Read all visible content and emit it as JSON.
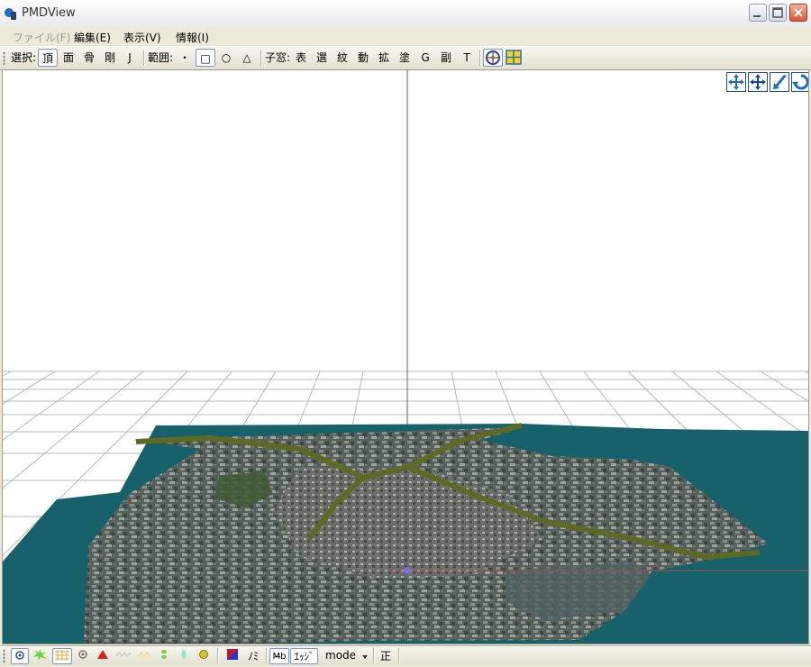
{
  "window": {
    "title": "PMDView"
  },
  "menu": [
    {
      "label": "ファイル(F)",
      "enabled": false
    },
    {
      "label": "編集(E)",
      "enabled": true
    },
    {
      "label": "表示(V)",
      "enabled": true
    },
    {
      "label": "情報(I)",
      "enabled": true
    }
  ],
  "toolbar": {
    "select_label": "選択:",
    "select_vertex": "頂",
    "select_face": "面",
    "select_bone": "骨",
    "select_rigid": "剛",
    "select_joint": "J",
    "range_label": "範囲:",
    "range_point": "・",
    "range_rect": "□",
    "range_circle": "○",
    "range_triangle": "△",
    "child_label": "子窓:",
    "child_table": "表",
    "child_select": "選",
    "child_morph": "紋",
    "child_motion": "動",
    "child_extend": "拡",
    "child_paint": "塗",
    "child_g": "G",
    "child_sub": "副",
    "child_t": "T"
  },
  "statusbar": {
    "nomi_label": "ﾉﾐ",
    "mb_label": "M̶b",
    "edge_label": "ｴｯｼﾞ",
    "mode_label": "mode",
    "sei_label": "正"
  },
  "colors": {
    "ground": "#17616a",
    "city_dark": "#4a4f4c",
    "city_light": "#8b8f8a",
    "river": "#5e6a24",
    "axis_green": "#2f8a2f",
    "axis_red": "#c24a4a",
    "grid": "#b8b8b8"
  },
  "icons": {
    "app": "pmd-app-icon",
    "nav": [
      "move-xy-icon",
      "move-xz-icon",
      "zoom-icon",
      "rotate-icon"
    ],
    "view": [
      "center-target-icon",
      "quad-view-icon"
    ],
    "status": [
      "vertex-display-icon",
      "bone-display-icon",
      "grid-display-icon",
      "point-display-icon",
      "face-display-icon",
      "line-display-icon",
      "light-display-icon",
      "green-bone-icon",
      "cyan-bone-icon",
      "yellow-ball-icon",
      "color-swatch-icon"
    ]
  }
}
